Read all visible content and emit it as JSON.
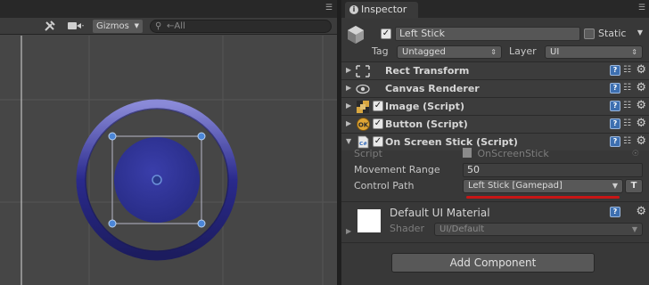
{
  "scene": {
    "gizmos_label": "Gizmos",
    "search_placeholder": "←All"
  },
  "inspector": {
    "tab_label": "Inspector",
    "gameobject": {
      "name": "Left Stick",
      "static_label": "Static",
      "tag_label": "Tag",
      "tag_value": "Untagged",
      "layer_label": "Layer",
      "layer_value": "UI"
    },
    "components": [
      {
        "title": "Rect Transform"
      },
      {
        "title": "Canvas Renderer"
      },
      {
        "title": "Image (Script)"
      },
      {
        "title": "Button (Script)"
      },
      {
        "title": "On Screen Stick (Script)"
      }
    ],
    "on_screen_stick": {
      "script_label": "Script",
      "script_value": "OnScreenStick",
      "movement_range_label": "Movement Range",
      "movement_range_value": "50",
      "control_path_label": "Control Path",
      "control_path_value": "Left Stick [Gamepad]",
      "t_button": "T"
    },
    "material": {
      "name": "Default UI Material",
      "shader_label": "Shader",
      "shader_value": "UI/Default"
    },
    "add_component_label": "Add Component"
  },
  "colors": {
    "accent_underline": "#c81616",
    "joystick_ring": "#2c2c86",
    "joystick_knob": "#30339a",
    "handle": "#4b86d8"
  }
}
